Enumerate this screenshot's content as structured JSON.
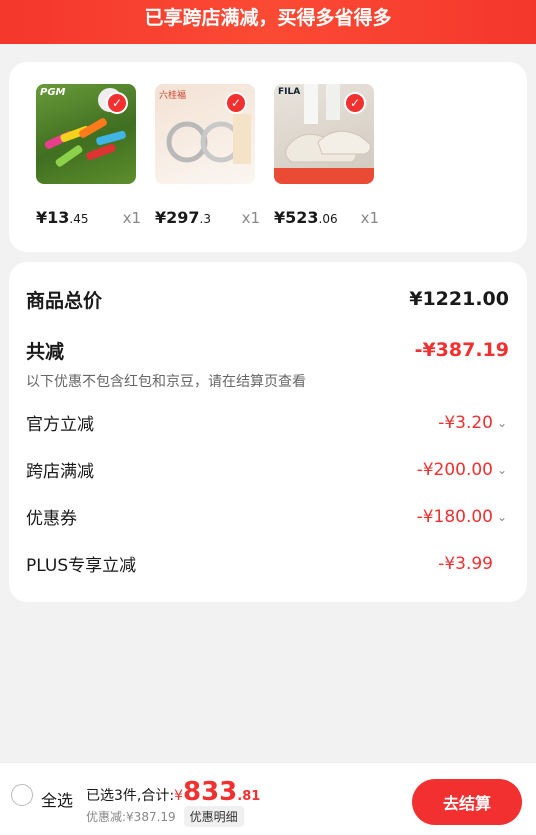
{
  "banner": {
    "text": "已享跨店满减，买得多省得多"
  },
  "products": [
    {
      "price_int": "¥13",
      "price_dec": ".45",
      "qty": "x1",
      "brand": "PGM"
    },
    {
      "price_int": "¥297",
      "price_dec": ".3",
      "qty": "x1",
      "brand": "六桂福"
    },
    {
      "price_int": "¥523",
      "price_dec": ".06",
      "qty": "x1",
      "brand": "FILA"
    }
  ],
  "summary": {
    "total_label": "商品总价",
    "total_value": "¥1221.00",
    "reduce_label": "共减",
    "reduce_value": "-¥387.19",
    "note": "以下优惠不包含红包和京豆，请在结算页查看",
    "items": [
      {
        "label": "官方立减",
        "value": "-¥3.20"
      },
      {
        "label": "跨店满减",
        "value": "-¥200.00"
      },
      {
        "label": "优惠券",
        "value": "-¥180.00"
      },
      {
        "label": "PLUS专享立减",
        "value": "-¥3.99"
      }
    ]
  },
  "bottom": {
    "select_all": "全选",
    "selected": "已选3件,合计:",
    "yen": "¥",
    "int": "833",
    "dec": ".81",
    "discount": "优惠减:¥387.19",
    "detail": "优惠明细",
    "checkout": "去结算"
  },
  "colors": {
    "accent": "#f23030",
    "background": "#f2f2f2"
  }
}
